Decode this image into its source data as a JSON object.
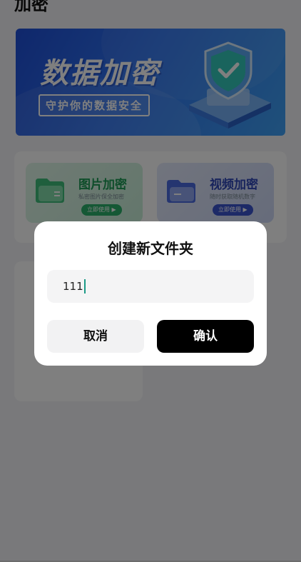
{
  "page": {
    "title": "加密"
  },
  "banner": {
    "title": "数据加密",
    "subtitle": "守护你的数据安全"
  },
  "features": {
    "image": {
      "name": "图片加密",
      "desc": "私密图片保全加密",
      "action": "立即使用 ▶"
    },
    "video": {
      "name": "视频加密",
      "desc": "随时获取随机数字",
      "action": "立即使用 ▶"
    }
  },
  "dialog": {
    "title": "创建新文件夹",
    "input_value": "111",
    "cancel_label": "取消",
    "confirm_label": "确认"
  },
  "colors": {
    "banner_blue": "#2f74f0",
    "image_green": "#1c9a55",
    "video_blue": "#3148b8",
    "confirm_bg": "#000000",
    "caret": "#1a9a86"
  }
}
